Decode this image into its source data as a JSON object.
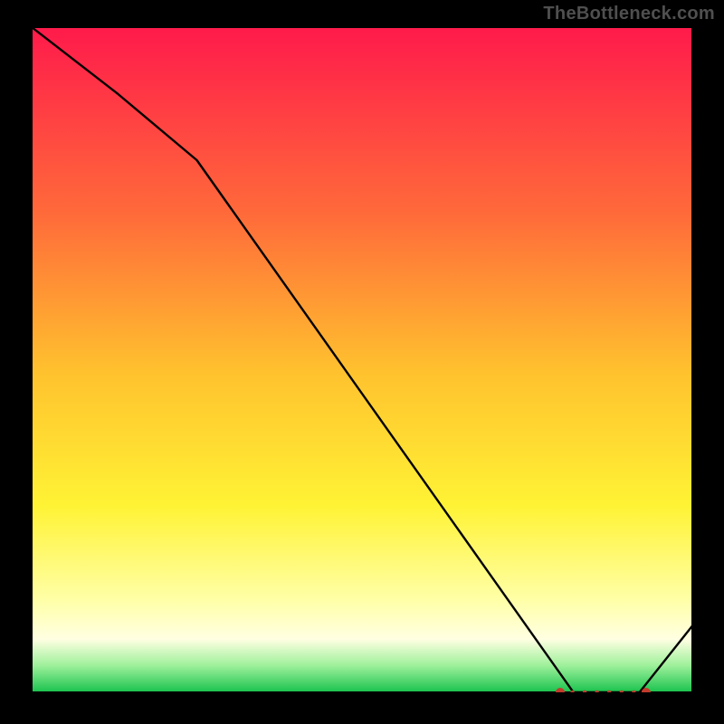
{
  "attribution": "TheBottleneck.com",
  "chart_data": {
    "type": "line",
    "title": "",
    "xlabel": "",
    "ylabel": "",
    "x": [
      0.0,
      0.13,
      0.25,
      0.82,
      0.92,
      1.0
    ],
    "values": [
      1.0,
      0.9,
      0.8,
      0.0,
      0.0,
      0.1
    ],
    "xlim": [
      0,
      1
    ],
    "ylim": [
      0,
      1
    ],
    "background_gradient_stops": [
      {
        "offset": 0.0,
        "color": "#ff1a4b"
      },
      {
        "offset": 0.28,
        "color": "#ff6a3a"
      },
      {
        "offset": 0.52,
        "color": "#ffc22e"
      },
      {
        "offset": 0.72,
        "color": "#fff335"
      },
      {
        "offset": 0.86,
        "color": "#ffffa6"
      },
      {
        "offset": 0.92,
        "color": "#ffffe2"
      },
      {
        "offset": 0.96,
        "color": "#9df09a"
      },
      {
        "offset": 1.0,
        "color": "#19c24d"
      }
    ],
    "bottom_marker": {
      "x_start": 0.8,
      "x_end": 0.93,
      "y": 0.0,
      "large_dot_radius": 5,
      "small_dot_radius": 2.2,
      "small_dot_count": 6,
      "color": "#c23b2c"
    },
    "line_color": "#000000",
    "line_width": 2.4
  }
}
